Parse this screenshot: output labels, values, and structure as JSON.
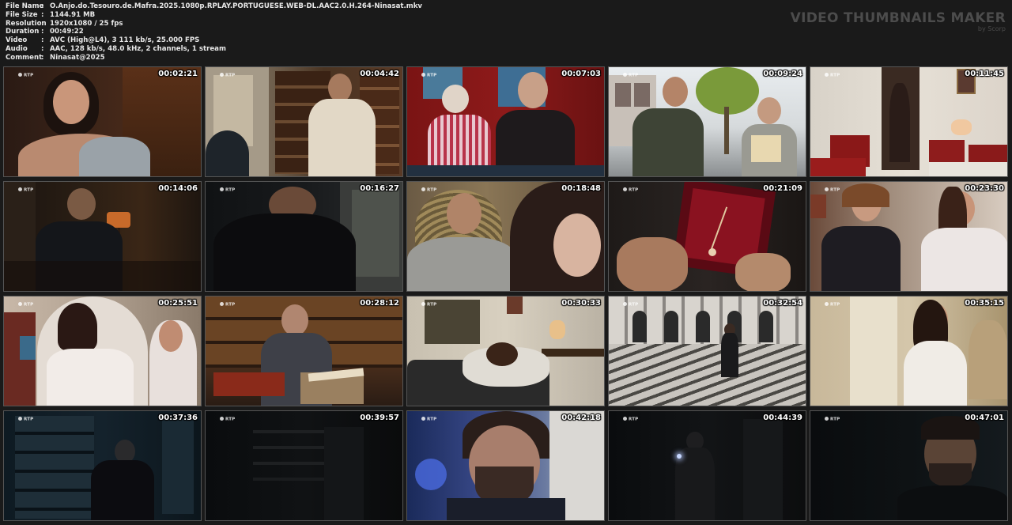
{
  "info": {
    "rows": [
      {
        "label": "File Name",
        "value": "O.Anjo.do.Tesouro.de.Mafra.2025.1080p.RPLAY.PORTUGUESE.WEB-DL.AAC2.0.H.264-Ninasat.mkv"
      },
      {
        "label": "File Size",
        "value": "1144.91 MB"
      },
      {
        "label": "Resolution",
        "value": "1920x1080 / 25 fps"
      },
      {
        "label": "Duration",
        "value": "00:49:22"
      },
      {
        "label": "Video",
        "value": "AVC (High@L4), 3 111 kb/s, 25.000 FPS"
      },
      {
        "label": "Audio",
        "value": "AAC, 128 kb/s, 48.0 kHz, 2 channels, 1 stream"
      },
      {
        "label": "Comment",
        "value": "Ninasat@2025"
      }
    ],
    "separator": ":"
  },
  "brand": {
    "title": "VIDEO THUMBNAILS MAKER",
    "subtitle": "by Scorp"
  },
  "thumbnails": [
    {
      "time": "00:02:21",
      "logo": "RTP"
    },
    {
      "time": "00:04:42",
      "logo": "RTP"
    },
    {
      "time": "00:07:03",
      "logo": "RTP"
    },
    {
      "time": "00:09:24",
      "logo": "RTP"
    },
    {
      "time": "00:11:45",
      "logo": "RTP"
    },
    {
      "time": "00:14:06",
      "logo": "RTP"
    },
    {
      "time": "00:16:27",
      "logo": "RTP"
    },
    {
      "time": "00:18:48",
      "logo": "RTP"
    },
    {
      "time": "00:21:09",
      "logo": "RTP"
    },
    {
      "time": "00:23:30",
      "logo": "RTP"
    },
    {
      "time": "00:25:51",
      "logo": "RTP"
    },
    {
      "time": "00:28:12",
      "logo": "RTP"
    },
    {
      "time": "00:30:33",
      "logo": "RTP"
    },
    {
      "time": "00:32:54",
      "logo": "RTP"
    },
    {
      "time": "00:35:15",
      "logo": "RTP"
    },
    {
      "time": "00:37:36",
      "logo": "RTP"
    },
    {
      "time": "00:39:57",
      "logo": "RTP"
    },
    {
      "time": "00:42:18",
      "logo": "RTP"
    },
    {
      "time": "00:44:39",
      "logo": "RTP"
    },
    {
      "time": "00:47:01",
      "logo": "RTP"
    }
  ],
  "colors": {
    "background": "#1a1a1a",
    "info_text": "#e8e8e8",
    "brand_text": "#4c4c4c",
    "timestamp": "#ffffff"
  }
}
